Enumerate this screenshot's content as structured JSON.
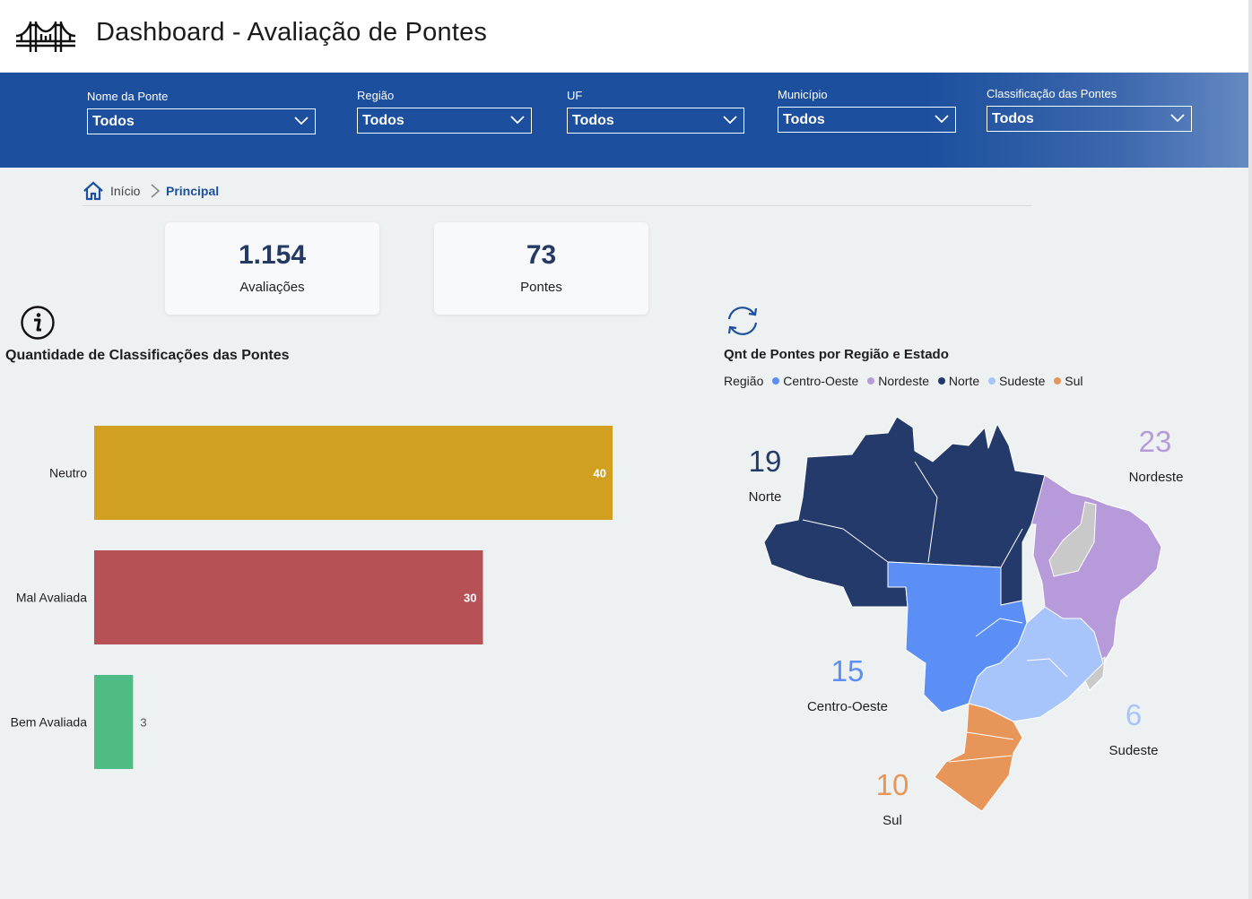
{
  "header": {
    "title": "Dashboard - Avaliação de Pontes",
    "logo_icon": "bridge-icon"
  },
  "filters": [
    {
      "label": "Nome da Ponte",
      "value": "Todos"
    },
    {
      "label": "Região",
      "value": "Todos"
    },
    {
      "label": "UF",
      "value": "Todos"
    },
    {
      "label": "Município",
      "value": "Todos"
    },
    {
      "label": "Classificação das Pontes",
      "value": "Todos"
    }
  ],
  "breadcrumb": {
    "home_icon": "home-icon",
    "inicio": "Início",
    "current": "Principal"
  },
  "kpis": [
    {
      "value": "1.154",
      "label": "Avaliações"
    },
    {
      "value": "73",
      "label": "Pontes"
    }
  ],
  "left_panel": {
    "info_icon": "info-icon"
  },
  "map_panel": {
    "refresh_icon": "refresh-icon",
    "title": "Qnt de Pontes por Região e Estado",
    "legend_title": "Região",
    "legend": [
      {
        "name": "Centro-Oeste",
        "color": "#5b8ff5"
      },
      {
        "name": "Nordeste",
        "color": "#b79ad9"
      },
      {
        "name": "Norte",
        "color": "#243a6b"
      },
      {
        "name": "Sudeste",
        "color": "#a7c4fb"
      },
      {
        "name": "Sul",
        "color": "#e8955a"
      }
    ],
    "regions": [
      {
        "name": "Norte",
        "count": "19",
        "color": "#243a6b"
      },
      {
        "name": "Nordeste",
        "count": "23",
        "color": "#b79ad9"
      },
      {
        "name": "Centro-Oeste",
        "count": "15",
        "color": "#5b8ff5"
      },
      {
        "name": "Sudeste",
        "count": "6",
        "color": "#a7c4fb"
      },
      {
        "name": "Sul",
        "count": "10",
        "color": "#e8955a"
      }
    ]
  },
  "chart_data": {
    "type": "bar",
    "orientation": "horizontal",
    "title": "Quantidade de Classificações das Pontes",
    "categories": [
      "Neutro",
      "Mal Avaliada",
      "Bem Avaliada"
    ],
    "values": [
      40,
      30,
      3
    ],
    "colors": [
      "#d1a020",
      "#b65256",
      "#4fbb85"
    ],
    "xlim": [
      0,
      40
    ],
    "grid": false,
    "data_labels": true
  }
}
